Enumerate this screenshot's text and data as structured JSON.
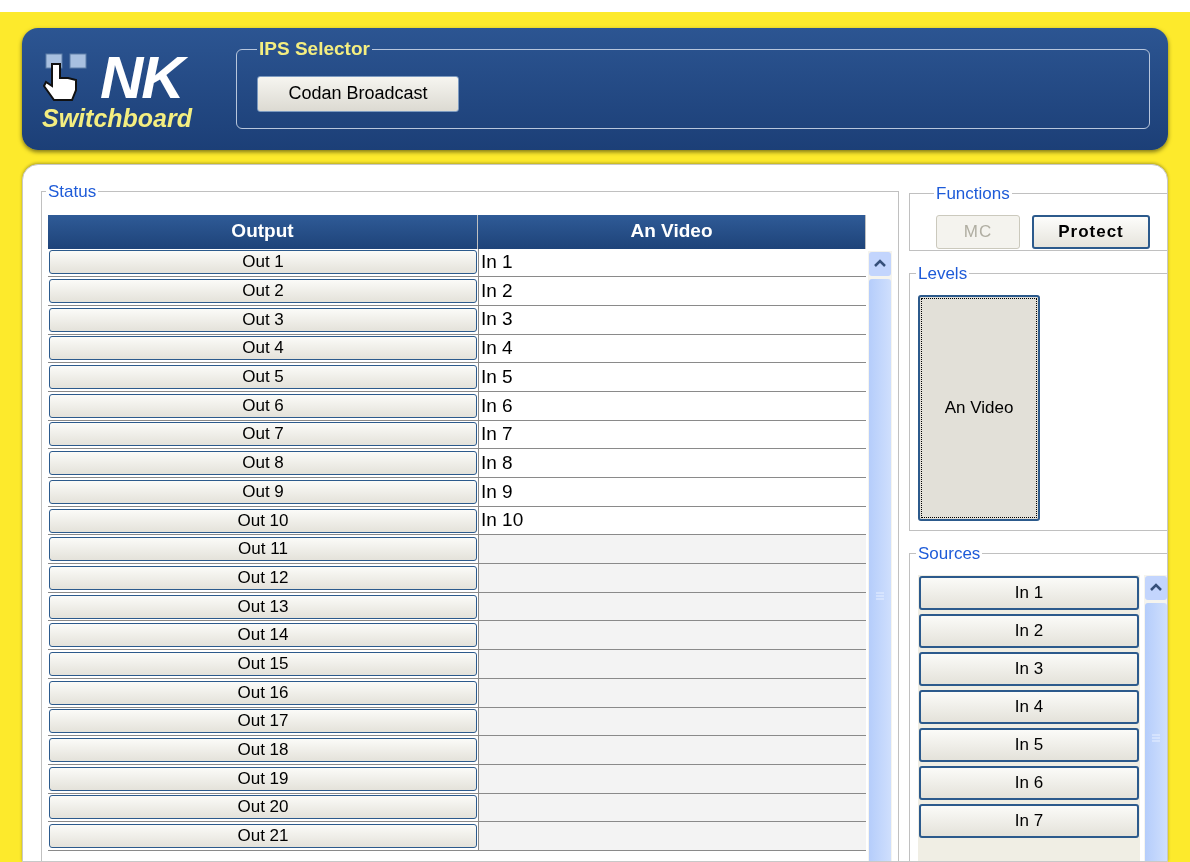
{
  "logo": {
    "title": "NK",
    "subtitle": "Switchboard"
  },
  "ips_selector": {
    "label": "IPS Selector",
    "button": "Codan Broadcast"
  },
  "status": {
    "label": "Status",
    "columns": [
      "Output",
      "An Video"
    ],
    "rows": [
      {
        "output": "Out 1",
        "video": "In 1"
      },
      {
        "output": "Out 2",
        "video": "In 2"
      },
      {
        "output": "Out 3",
        "video": "In 3"
      },
      {
        "output": "Out 4",
        "video": "In 4"
      },
      {
        "output": "Out 5",
        "video": "In 5"
      },
      {
        "output": "Out 6",
        "video": "In 6"
      },
      {
        "output": "Out 7",
        "video": "In 7"
      },
      {
        "output": "Out 8",
        "video": "In 8"
      },
      {
        "output": "Out 9",
        "video": "In 9"
      },
      {
        "output": "Out 10",
        "video": "In 10"
      },
      {
        "output": "Out 11"
      },
      {
        "output": "Out 12"
      },
      {
        "output": "Out 13"
      },
      {
        "output": "Out 14"
      },
      {
        "output": "Out 15"
      },
      {
        "output": "Out 16"
      },
      {
        "output": "Out 17"
      },
      {
        "output": "Out 18"
      },
      {
        "output": "Out 19"
      },
      {
        "output": "Out 20"
      },
      {
        "output": "Out 21"
      }
    ]
  },
  "functions": {
    "label": "Functions",
    "buttons": [
      {
        "label": "MC",
        "disabled": true
      },
      {
        "label": "Protect",
        "disabled": false
      }
    ]
  },
  "levels": {
    "label": "Levels",
    "items": [
      {
        "label": "An Video",
        "selected": true
      }
    ]
  },
  "sources": {
    "label": "Sources",
    "items": [
      "In 1",
      "In 2",
      "In 3",
      "In 4",
      "In 5",
      "In 6",
      "In 7"
    ]
  }
}
